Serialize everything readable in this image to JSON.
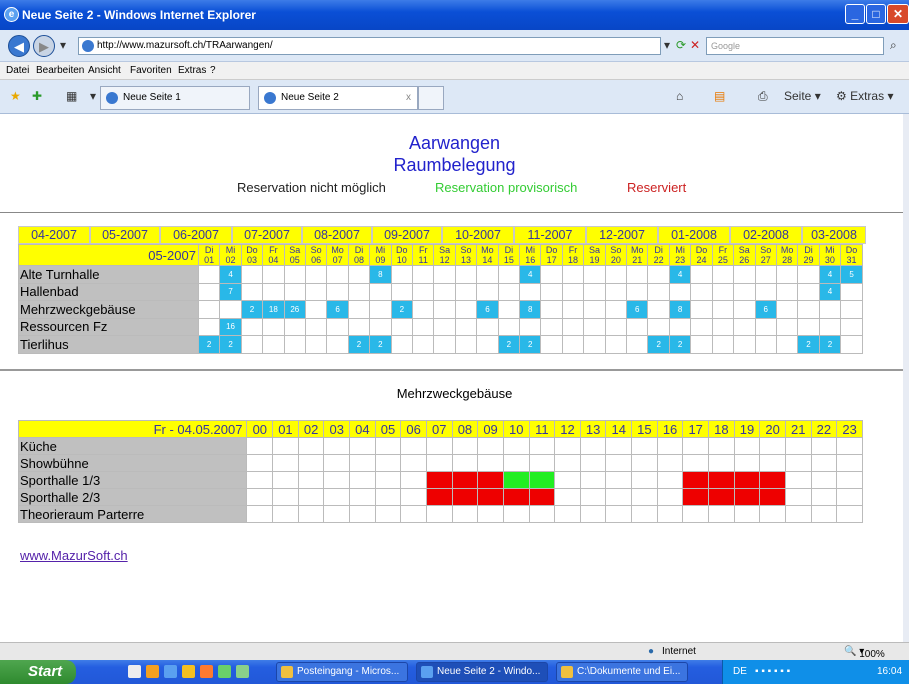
{
  "window": {
    "title": "Neue Seite 2 - Windows Internet Explorer"
  },
  "address": {
    "url": "http://www.mazursoft.ch/TRAarwangen/",
    "search_placeholder": "Google"
  },
  "menu": [
    "Datei",
    "Bearbeiten",
    "Ansicht",
    "Favoriten",
    "Extras",
    "?"
  ],
  "tabs": [
    "Neue Seite 1",
    "Neue Seite 2"
  ],
  "toolbar": {
    "page": "Seite",
    "tools": "Extras"
  },
  "page": {
    "title1": "Aarwangen",
    "title2": "Raumbelegung",
    "legend": {
      "not_possible": "Reservation nicht möglich",
      "provisional": "Reservation provisorisch",
      "reserved": "Reserviert"
    },
    "legend_colors": {
      "not_possible": "#222222",
      "provisional": "#33cc33",
      "reserved": "#cc2222"
    },
    "months": [
      "04-2007",
      "05-2007",
      "06-2007",
      "07-2007",
      "08-2007",
      "09-2007",
      "10-2007",
      "11-2007",
      "12-2007",
      "01-2008",
      "02-2008",
      "03-2008"
    ],
    "selected_month": "05-2007",
    "weekdays": [
      "Di",
      "Mi",
      "Do",
      "Fr",
      "Sa",
      "So",
      "Mo",
      "Di",
      "Mi",
      "Do",
      "Fr",
      "Sa",
      "So",
      "Mo",
      "Di",
      "Mi",
      "Do",
      "Fr",
      "Sa",
      "So",
      "Mo",
      "Di",
      "Mi",
      "Do",
      "Fr",
      "Sa",
      "So",
      "Mo",
      "Di",
      "Mi",
      "Do"
    ],
    "days": [
      "01",
      "02",
      "03",
      "04",
      "05",
      "06",
      "07",
      "08",
      "09",
      "10",
      "11",
      "12",
      "13",
      "14",
      "15",
      "16",
      "17",
      "18",
      "19",
      "20",
      "21",
      "22",
      "23",
      "24",
      "25",
      "26",
      "27",
      "28",
      "29",
      "30",
      "31"
    ],
    "rooms": [
      {
        "name": "Alte Turnhalle",
        "cells": {
          "2": "4",
          "9": "8",
          "16": "4",
          "23": "4",
          "30": "4",
          "31": "5"
        }
      },
      {
        "name": "Hallenbad",
        "cells": {
          "2": "7",
          "30": "4"
        }
      },
      {
        "name": "Mehrzweckgebäuse",
        "cells": {
          "3": "2",
          "4": "18",
          "5": "26",
          "7": "6",
          "10": "2",
          "14": "6",
          "16": "8",
          "21": "6",
          "23": "8",
          "27": "6"
        }
      },
      {
        "name": "Ressourcen Fz",
        "cells": {
          "2": "16"
        }
      },
      {
        "name": "Tierlihus",
        "cells": {
          "1": "2",
          "2": "2",
          "8": "2",
          "9": "2",
          "15": "2",
          "16": "2",
          "22": "2",
          "23": "2",
          "29": "2",
          "30": "2"
        }
      }
    ],
    "detail_title": "Mehrzweckgebäuse",
    "detail_date": "Fr - 04.05.2007",
    "hours": [
      "00",
      "01",
      "02",
      "03",
      "04",
      "05",
      "06",
      "07",
      "08",
      "09",
      "10",
      "11",
      "12",
      "13",
      "14",
      "15",
      "16",
      "17",
      "18",
      "19",
      "20",
      "21",
      "22",
      "23"
    ],
    "detail_rows": [
      {
        "name": "Küche",
        "slots": {}
      },
      {
        "name": "Showbühne",
        "slots": {}
      },
      {
        "name": "Sporthalle 1/3",
        "slots": {
          "07": "r",
          "08": "r",
          "09": "r",
          "10": "g",
          "11": "g",
          "17": "r",
          "18": "r",
          "19": "r",
          "20": "r"
        }
      },
      {
        "name": "Sporthalle 2/3",
        "slots": {
          "07": "r",
          "08": "r",
          "09": "r",
          "10": "r",
          "11": "r",
          "17": "r",
          "18": "r",
          "19": "r",
          "20": "r"
        }
      },
      {
        "name": "Theorieraum Parterre",
        "slots": {}
      }
    ],
    "footer_link": "www.MazurSoft.ch"
  },
  "status": {
    "zone": "Internet",
    "zoom": "100%"
  },
  "taskbar": {
    "start": "Start",
    "items": [
      "Posteingang - Micros...",
      "Neue Seite 2 - Windo...",
      "C:\\Dokumente und Ei..."
    ],
    "lang": "DE",
    "time": "16:04"
  }
}
